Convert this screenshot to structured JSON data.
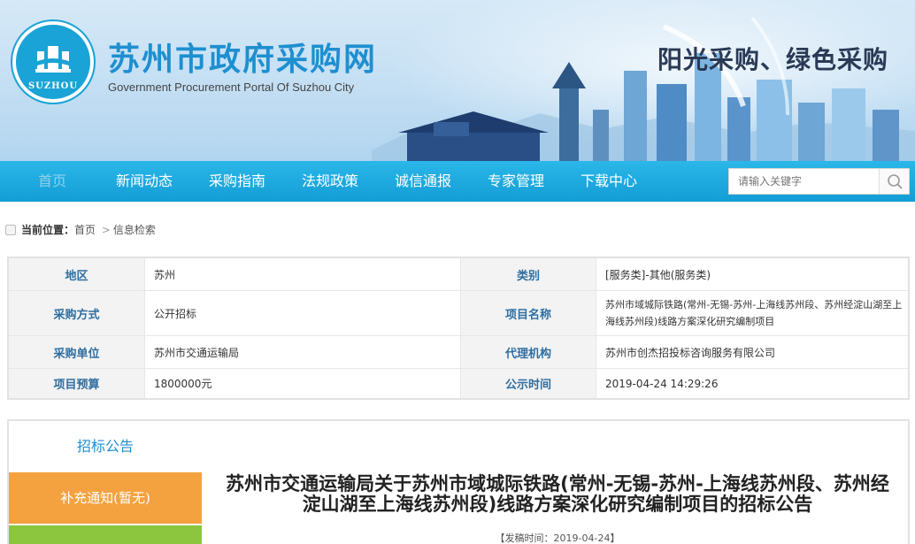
{
  "header": {
    "title": "苏州市政府采购网",
    "subtitle": "Government Procurement Portal Of Suzhou City",
    "logo_text": "SUZHOU",
    "slogan": "阳光采购、绿色采购"
  },
  "nav": {
    "items": [
      "首页",
      "新闻动态",
      "采购指南",
      "法规政策",
      "诚信通报",
      "专家管理",
      "下载中心"
    ],
    "search_placeholder": "请输入关键字"
  },
  "breadcrumb": {
    "label": "当前位置：",
    "home": "首页",
    "sep": ">",
    "current": "信息检索"
  },
  "info": {
    "rows": [
      {
        "l1": "地区",
        "v1": "苏州",
        "l2": "类别",
        "v2": "[服务类]-其他(服务类)"
      },
      {
        "l1": "采购方式",
        "v1": "公开招标",
        "l2": "项目名称",
        "v2": "苏州市域城际铁路(常州-无锡-苏州-上海线苏州段、苏州经淀山湖至上海线苏州段)线路方案深化研究编制项目"
      },
      {
        "l1": "采购单位",
        "v1": "苏州市交通运输局",
        "l2": "代理机构",
        "v2": "苏州市创杰招投标咨询服务有限公司"
      },
      {
        "l1": "项目预算",
        "v1": "1800000元",
        "l2": "公示时间",
        "v2": "2019-04-24 14:29:26"
      }
    ]
  },
  "sidebar": {
    "title": "招标公告",
    "tab1": "补充通知(暂无)"
  },
  "notice": {
    "title": "苏州市交通运输局关于苏州市域城际铁路(常州-无锡-苏州-上海线苏州段、苏州经淀山湖至上海线苏州段)线路方案深化研究编制项目的招标公告",
    "date": "【发稿时间：2019-04-24】"
  },
  "colors": {
    "nav": "#139dd6",
    "title": "#1e8fd0",
    "label": "#2f6ea0",
    "tab_orange": "#f4a23f",
    "tab_green": "#8cc63e"
  }
}
